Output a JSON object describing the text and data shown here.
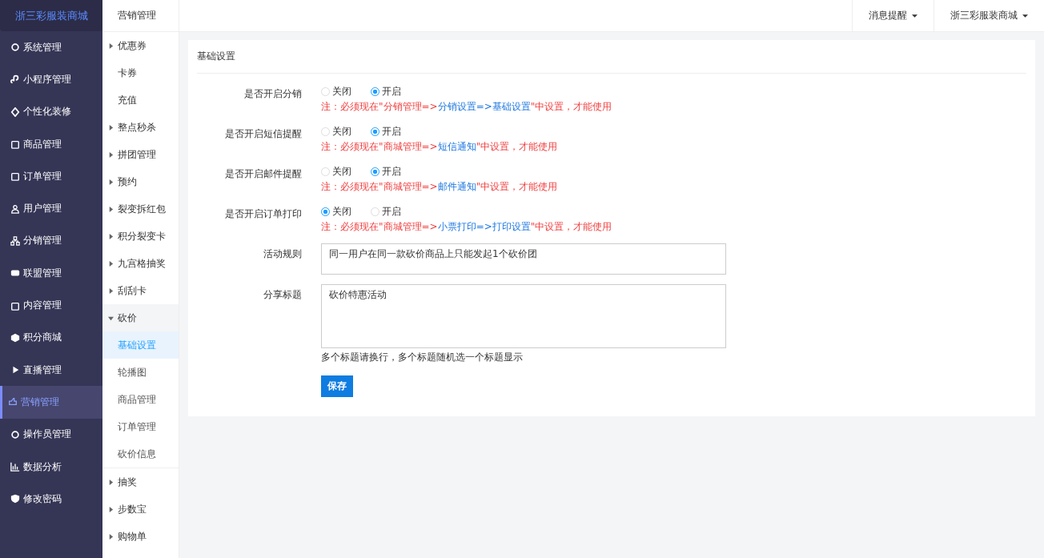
{
  "logo": "浙三彩服装商城",
  "sidebar": {
    "items": [
      {
        "label": "系统管理",
        "selected": false
      },
      {
        "label": "小程序管理",
        "selected": false
      },
      {
        "label": "个性化装修",
        "selected": false
      },
      {
        "label": "商品管理",
        "selected": false
      },
      {
        "label": "订单管理",
        "selected": false
      },
      {
        "label": "用户管理",
        "selected": false
      },
      {
        "label": "分销管理",
        "selected": false
      },
      {
        "label": "联盟管理",
        "selected": false
      },
      {
        "label": "内容管理",
        "selected": false
      },
      {
        "label": "积分商城",
        "selected": false
      },
      {
        "label": "直播管理",
        "selected": false
      },
      {
        "label": "营销管理",
        "selected": true
      },
      {
        "label": "操作员管理",
        "selected": false
      },
      {
        "label": "数据分析",
        "selected": false
      },
      {
        "label": "修改密码",
        "selected": false
      }
    ]
  },
  "submenu": {
    "title": "营销管理",
    "items": [
      {
        "kind": "group",
        "label": "优惠券",
        "expanded": false
      },
      {
        "kind": "leaf",
        "label": "卡券",
        "selected": false
      },
      {
        "kind": "leaf",
        "label": "充值",
        "selected": false
      },
      {
        "kind": "group",
        "label": "整点秒杀",
        "expanded": false
      },
      {
        "kind": "group",
        "label": "拼团管理",
        "expanded": false
      },
      {
        "kind": "group",
        "label": "预约",
        "expanded": false
      },
      {
        "kind": "group",
        "label": "裂变拆红包",
        "expanded": false
      },
      {
        "kind": "group",
        "label": "积分裂变卡",
        "expanded": false
      },
      {
        "kind": "group",
        "label": "九宫格抽奖",
        "expanded": false
      },
      {
        "kind": "group",
        "label": "刮刮卡",
        "expanded": false
      },
      {
        "kind": "group",
        "label": "砍价",
        "expanded": true,
        "children": [
          {
            "label": "基础设置",
            "selected": true
          },
          {
            "label": "轮播图",
            "selected": false
          },
          {
            "label": "商品管理",
            "selected": false
          },
          {
            "label": "订单管理",
            "selected": false
          },
          {
            "label": "砍价信息",
            "selected": false
          }
        ]
      },
      {
        "kind": "group",
        "label": "抽奖",
        "expanded": false
      },
      {
        "kind": "group",
        "label": "步数宝",
        "expanded": false
      },
      {
        "kind": "group",
        "label": "购物单",
        "expanded": false
      }
    ]
  },
  "topbar": {
    "menus": [
      "消息提醒",
      "浙三彩服装商城"
    ]
  },
  "card": {
    "title": "基础设置",
    "radio_rows": [
      {
        "label": "是否开启分销",
        "options": [
          {
            "label": "关闭",
            "selected": false
          },
          {
            "label": "开启",
            "selected": true
          }
        ],
        "note": {
          "before": "注：必须现在\"分销管理=>",
          "link": "分销设置=>基础设置",
          "after": "\"中设置，才能使用"
        }
      },
      {
        "label": "是否开启短信提醒",
        "options": [
          {
            "label": "关闭",
            "selected": false
          },
          {
            "label": "开启",
            "selected": true
          }
        ],
        "note": {
          "before": "注：必须现在\"商城管理=>",
          "link": "短信通知",
          "after": "\"中设置，才能使用"
        }
      },
      {
        "label": "是否开启邮件提醒",
        "options": [
          {
            "label": "关闭",
            "selected": false
          },
          {
            "label": "开启",
            "selected": true
          }
        ],
        "note": {
          "before": "注：必须现在\"商城管理=>",
          "link": "邮件通知",
          "after": "\"中设置，才能使用"
        }
      },
      {
        "label": "是否开启订单打印",
        "options": [
          {
            "label": "关闭",
            "selected": true
          },
          {
            "label": "开启",
            "selected": false
          }
        ],
        "note": {
          "before": "注：必须现在\"商城管理=>",
          "link": "小票打印=>打印设置",
          "after": "\"中设置，才能使用"
        }
      }
    ],
    "activity_rule": {
      "label": "活动规则",
      "value": "同一用户在同一款砍价商品上只能发起1个砍价团"
    },
    "share_title": {
      "label": "分享标题",
      "value": "砍价特惠活动",
      "help": "多个标题请换行，多个标题随机选一个标题显示"
    },
    "save_button": "保存"
  }
}
